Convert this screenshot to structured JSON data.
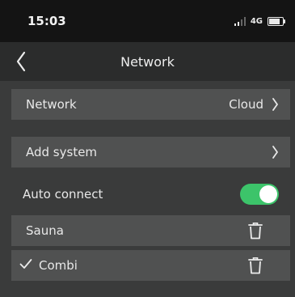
{
  "status_bar": {
    "time": "15:03",
    "network": "4G",
    "battery_level": 0.8
  },
  "nav": {
    "title": "Network"
  },
  "rows": {
    "network": {
      "label": "Network",
      "value": "Cloud"
    },
    "add_system": {
      "label": "Add system"
    },
    "auto_connect": {
      "label": "Auto connect",
      "enabled": true
    }
  },
  "systems": [
    {
      "name": "Sauna",
      "selected": false
    },
    {
      "name": "Combi",
      "selected": true
    }
  ],
  "colors": {
    "toggle_on": "#3cc46a",
    "card": "#505151",
    "background": "#3a3b3b",
    "status_bar": "#141414"
  },
  "icons": [
    "back-chevron-icon",
    "chevron-right-icon",
    "trash-icon",
    "checkmark-icon",
    "signal-icon",
    "battery-icon"
  ]
}
